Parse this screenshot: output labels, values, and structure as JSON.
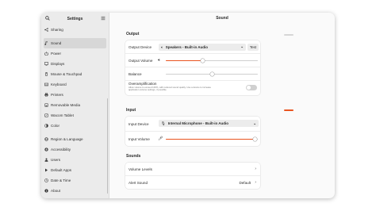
{
  "sidebar": {
    "title": "Settings",
    "items": [
      {
        "label": "Sharing",
        "icon": "share-icon"
      },
      {
        "label": "Sound",
        "icon": "music-note-icon",
        "active": true
      },
      {
        "label": "Power",
        "icon": "power-icon"
      },
      {
        "label": "Displays",
        "icon": "monitor-icon"
      },
      {
        "label": "Mouse & Touchpad",
        "icon": "mouse-icon"
      },
      {
        "label": "Keyboard",
        "icon": "keyboard-icon"
      },
      {
        "label": "Printers",
        "icon": "printer-icon"
      },
      {
        "label": "Removable Media",
        "icon": "removable-media-icon"
      },
      {
        "label": "Wacom Tablet",
        "icon": "tablet-icon"
      },
      {
        "label": "Color",
        "icon": "color-icon"
      },
      {
        "label": "Region & Language",
        "icon": "globe-icon"
      },
      {
        "label": "Accessibility",
        "icon": "accessibility-icon"
      },
      {
        "label": "Users",
        "icon": "users-icon"
      },
      {
        "label": "Default Apps",
        "icon": "apps-icon"
      },
      {
        "label": "Date & Time",
        "icon": "clock-icon"
      },
      {
        "label": "About",
        "icon": "info-icon"
      }
    ]
  },
  "header": {
    "title": "Sound"
  },
  "output": {
    "section_label": "Output",
    "device_label": "Output Device",
    "device_value": "Speakers - Built-in Audio",
    "test_label": "Test",
    "volume_label": "Output Volume",
    "volume_level": 0.4,
    "balance_label": "Balance",
    "balance_level": 0.5,
    "overamp_label": "Overamplification",
    "overamp_desc": "Allow volume to exceed 100%, with reduced sound quality. Use a device to increase application volume settings, if possible.",
    "overamp_enabled": false
  },
  "input": {
    "section_label": "Input",
    "device_label": "Input Device",
    "device_value": "Internal Microphone - Built-in Audio",
    "volume_label": "Input Volume",
    "volume_level": 0.97
  },
  "sounds": {
    "section_label": "Sounds",
    "volume_levels_label": "Volume Levels",
    "alert_sound_label": "Alert Sound",
    "alert_sound_value": "Default"
  },
  "colors": {
    "accent": "#e95420"
  }
}
